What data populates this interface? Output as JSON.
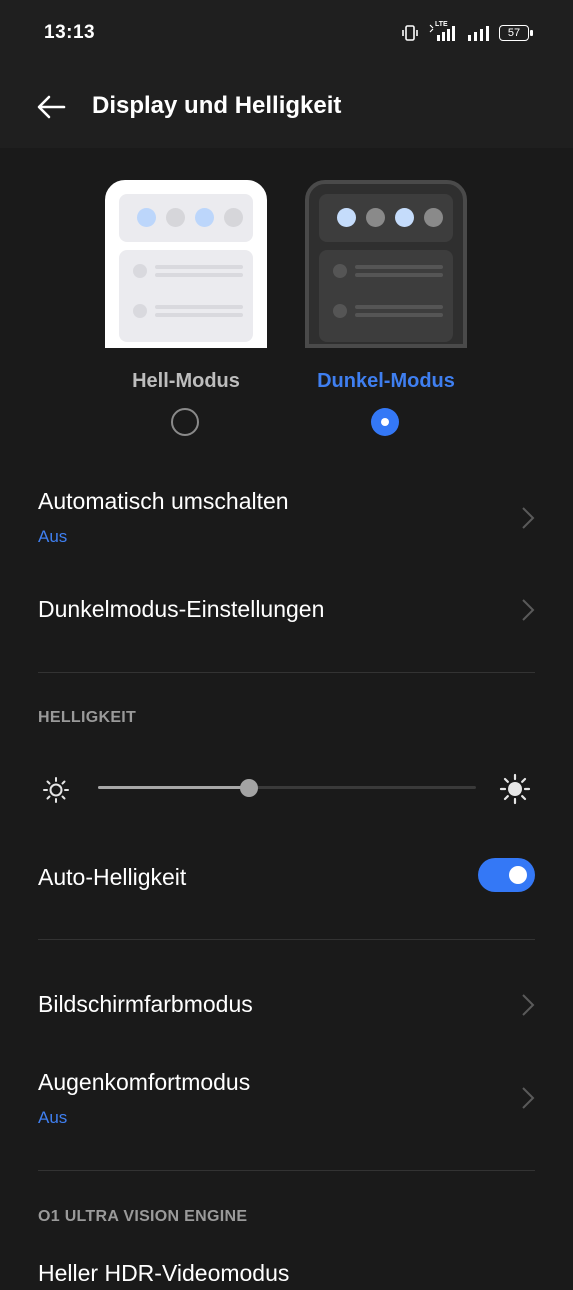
{
  "status_bar": {
    "time": "13:13",
    "network": "LTE",
    "battery": "57"
  },
  "header": {
    "title": "Display und Helligkeit"
  },
  "theme_modes": [
    {
      "label": "Hell-Modus",
      "selected": false
    },
    {
      "label": "Dunkel-Modus",
      "selected": true
    }
  ],
  "settings": {
    "auto_switch": {
      "title": "Automatisch umschalten",
      "value": "Aus"
    },
    "dark_mode_settings": {
      "title": "Dunkelmodus-Einstellungen"
    }
  },
  "brightness": {
    "section_title": "HELLIGKEIT",
    "level": 0.4,
    "auto_label": "Auto-Helligkeit",
    "auto_enabled": true
  },
  "display": {
    "color_mode": {
      "title": "Bildschirmfarbmodus"
    },
    "eye_comfort": {
      "title": "Augenkomfortmodus",
      "value": "Aus"
    }
  },
  "engine": {
    "section_title": "O1 ULTRA VISION ENGINE",
    "hdr_video": {
      "title": "Heller HDR-Videomodus"
    }
  },
  "colors": {
    "accent": "#3478f6",
    "background": "#1a1a1a",
    "light_dot": "#bcd6fb",
    "dark_dot_active": "#c5dcfb",
    "dark_dot_inactive": "#8a8a8a",
    "light_dot_inactive": "#d6d6da"
  }
}
